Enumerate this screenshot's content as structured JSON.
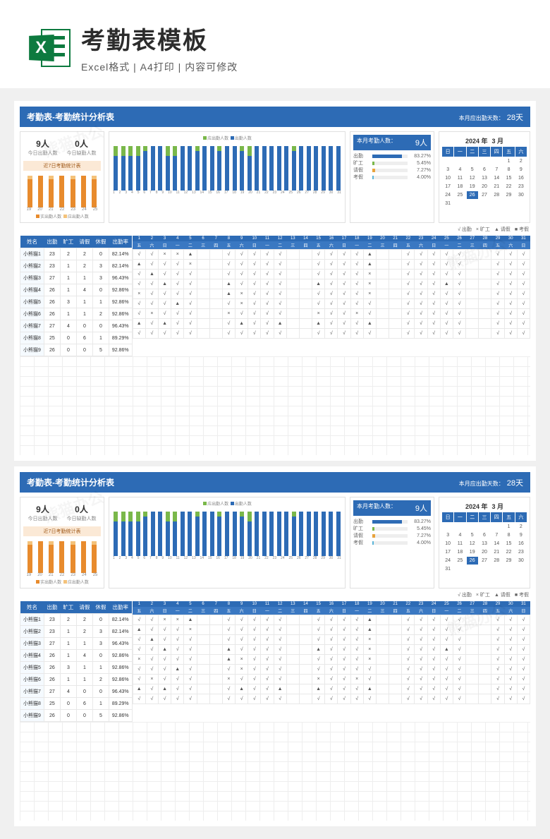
{
  "header": {
    "title": "考勤表模板",
    "subtitle": "Excel格式 | A4打印 | 内容可修改",
    "icon_letter": "X"
  },
  "sheet": {
    "banner_title": "考勤表-考勤统计分析表",
    "banner_days_label": "本月应出勤天数：",
    "banner_days_value": "28天",
    "today_present_value": "9人",
    "today_present_label": "今日出勤人数",
    "today_absent_value": "0人",
    "today_absent_label": "今日缺勤人数",
    "mini_title": "近7日考勤统计表",
    "mini_legend_a": "实出勤人数",
    "mini_legend_b": "应出勤人数",
    "bc_legend_a": "应出勤人数",
    "bc_legend_b": "出勤人数",
    "kpi_head_label": "本月考勤人数：",
    "kpi_head_value": "9人",
    "kpi": [
      {
        "name": "出勤",
        "pct": "83.27%",
        "w": 83,
        "c": "#2d6bb5"
      },
      {
        "name": "旷工",
        "pct": "5.45%",
        "w": 6,
        "c": "#7ab84a"
      },
      {
        "name": "请假",
        "pct": "7.27%",
        "w": 8,
        "c": "#e8a33d"
      },
      {
        "name": "考假",
        "pct": "4.00%",
        "w": 4,
        "c": "#5bb5d9"
      }
    ],
    "cal_year": "2024 年",
    "cal_month": "3 月",
    "cal_dow": [
      "日",
      "一",
      "二",
      "三",
      "四",
      "五",
      "六"
    ],
    "cal_days_leading_blank": 5,
    "cal_days": 31,
    "cal_highlight": 26,
    "legend": {
      "a": "√ 出勤",
      "b": "× 旷工",
      "c": "▲ 请假",
      "d": "■ 考假"
    },
    "cols": [
      "姓名",
      "出勤",
      "旷工",
      "请假",
      "休假",
      "出勤率"
    ],
    "rows": [
      {
        "name": "小熊猫1",
        "a": 23,
        "b": 2,
        "c": 2,
        "d": 0,
        "r": "82.14%"
      },
      {
        "name": "小熊猫2",
        "a": 23,
        "b": 1,
        "c": 2,
        "d": 3,
        "r": "82.14%"
      },
      {
        "name": "小熊猫3",
        "a": 27,
        "b": 1,
        "c": 1,
        "d": 3,
        "r": "96.43%"
      },
      {
        "name": "小熊猫4",
        "a": 26,
        "b": 1,
        "c": 4,
        "d": 0,
        "r": "92.86%"
      },
      {
        "name": "小熊猫5",
        "a": 26,
        "b": 3,
        "c": 1,
        "d": 1,
        "r": "92.86%"
      },
      {
        "name": "小熊猫6",
        "a": 26,
        "b": 1,
        "c": 1,
        "d": 2,
        "r": "92.86%"
      },
      {
        "name": "小熊猫7",
        "a": 27,
        "b": 4,
        "c": 0,
        "d": 0,
        "r": "96.43%"
      },
      {
        "name": "小熊猫8",
        "a": 25,
        "b": 0,
        "c": 6,
        "d": 1,
        "r": "89.29%"
      },
      {
        "name": "小熊猫9",
        "a": 26,
        "b": 0,
        "c": 0,
        "d": 5,
        "r": "92.86%"
      }
    ],
    "daily_marks": [
      [
        "√",
        "√",
        "×",
        "×",
        "▲",
        "",
        "",
        "√",
        "√",
        "√",
        "√",
        "√",
        "",
        "",
        "√",
        "√",
        "√",
        "√",
        "▲",
        "",
        "",
        "√",
        "√",
        "√",
        "√",
        "√",
        "",
        "",
        "√",
        "√",
        "√"
      ],
      [
        "▲",
        "√",
        "√",
        "√",
        "×",
        "",
        "",
        "√",
        "√",
        "√",
        "√",
        "√",
        "",
        "",
        "√",
        "√",
        "√",
        "√",
        "▲",
        "",
        "",
        "√",
        "√",
        "√",
        "√",
        "√",
        "",
        "",
        "√",
        "√",
        "√"
      ],
      [
        "√",
        "▲",
        "√",
        "√",
        "√",
        "",
        "",
        "√",
        "√",
        "√",
        "√",
        "√",
        "",
        "",
        "√",
        "√",
        "√",
        "√",
        "×",
        "",
        "",
        "√",
        "√",
        "√",
        "√",
        "√",
        "",
        "",
        "√",
        "√",
        "√"
      ],
      [
        "√",
        "√",
        "▲",
        "√",
        "√",
        "",
        "",
        "▲",
        "√",
        "√",
        "√",
        "√",
        "",
        "",
        "▲",
        "√",
        "√",
        "√",
        "×",
        "",
        "",
        "√",
        "√",
        "√",
        "▲",
        "√",
        "",
        "",
        "√",
        "√",
        "√"
      ],
      [
        "×",
        "√",
        "√",
        "√",
        "√",
        "",
        "",
        "▲",
        "×",
        "√",
        "√",
        "√",
        "",
        "",
        "√",
        "√",
        "√",
        "√",
        "×",
        "",
        "",
        "√",
        "√",
        "√",
        "√",
        "√",
        "",
        "",
        "√",
        "√",
        "√"
      ],
      [
        "√",
        "√",
        "√",
        "▲",
        "√",
        "",
        "",
        "√",
        "×",
        "√",
        "√",
        "√",
        "",
        "",
        "√",
        "√",
        "√",
        "√",
        "√",
        "",
        "",
        "√",
        "√",
        "√",
        "√",
        "√",
        "",
        "",
        "√",
        "√",
        "√"
      ],
      [
        "√",
        "×",
        "√",
        "√",
        "√",
        "",
        "",
        "×",
        "√",
        "√",
        "√",
        "√",
        "",
        "",
        "×",
        "√",
        "√",
        "×",
        "√",
        "",
        "",
        "√",
        "√",
        "√",
        "√",
        "√",
        "",
        "",
        "√",
        "√",
        "√"
      ],
      [
        "▲",
        "√",
        "▲",
        "√",
        "√",
        "",
        "",
        "√",
        "▲",
        "√",
        "√",
        "▲",
        "",
        "",
        "▲",
        "√",
        "√",
        "√",
        "▲",
        "",
        "",
        "√",
        "√",
        "√",
        "√",
        "√",
        "",
        "",
        "√",
        "√",
        "√"
      ],
      [
        "√",
        "√",
        "√",
        "√",
        "√",
        "",
        "",
        "√",
        "√",
        "√",
        "√",
        "√",
        "",
        "",
        "√",
        "√",
        "√",
        "√",
        "√",
        "",
        "",
        "√",
        "√",
        "√",
        "√",
        "√",
        "",
        "",
        "√",
        "√",
        "√"
      ]
    ],
    "day_dow": [
      "五",
      "六",
      "日",
      "一",
      "二",
      "三",
      "四",
      "五",
      "六",
      "日",
      "一",
      "二",
      "三",
      "四",
      "五",
      "六",
      "日",
      "一",
      "二",
      "三",
      "四",
      "五",
      "六",
      "日",
      "一",
      "二",
      "三",
      "四",
      "五",
      "六",
      "日"
    ]
  },
  "chart_data": [
    {
      "type": "bar",
      "title": "近7日考勤统计表",
      "categories": [
        "19",
        "20",
        "21",
        "22",
        "23",
        "24",
        "25"
      ],
      "series": [
        {
          "name": "实出勤人数",
          "values": [
            8,
            9,
            8,
            9,
            8,
            9,
            8
          ]
        },
        {
          "name": "应出勤人数",
          "values": [
            9,
            9,
            9,
            9,
            9,
            9,
            9
          ]
        }
      ],
      "ylim": [
        0,
        10
      ]
    },
    {
      "type": "bar",
      "title": "月度每日出勤",
      "categories": [
        "1",
        "2",
        "3",
        "4",
        "5",
        "6",
        "7",
        "8",
        "9",
        "10",
        "11",
        "12",
        "13",
        "14",
        "15",
        "16",
        "17",
        "18",
        "19",
        "20",
        "21",
        "22",
        "23",
        "24",
        "25",
        "26",
        "27",
        "28",
        "29",
        "30",
        "31"
      ],
      "series": [
        {
          "name": "应出勤人数",
          "values": [
            9,
            9,
            9,
            9,
            9,
            9,
            9,
            9,
            9,
            9,
            9,
            9,
            9,
            9,
            9,
            9,
            9,
            9,
            9,
            9,
            9,
            9,
            9,
            9,
            9,
            9,
            9,
            9,
            9,
            9,
            9
          ]
        },
        {
          "name": "出勤人数",
          "values": [
            7,
            7,
            7,
            7,
            8,
            9,
            9,
            7,
            7,
            9,
            9,
            8,
            9,
            9,
            8,
            9,
            9,
            8,
            7,
            9,
            9,
            9,
            9,
            9,
            8,
            9,
            9,
            9,
            9,
            9,
            9
          ]
        }
      ],
      "ylim": [
        0,
        10
      ]
    },
    {
      "type": "bar",
      "title": "本月考勤人数 9人",
      "categories": [
        "出勤",
        "旷工",
        "请假",
        "考假"
      ],
      "values": [
        83.27,
        5.45,
        7.27,
        4.0
      ],
      "ylabel": "%",
      "ylim": [
        0,
        100
      ]
    }
  ],
  "watermark": "熊猫办公"
}
